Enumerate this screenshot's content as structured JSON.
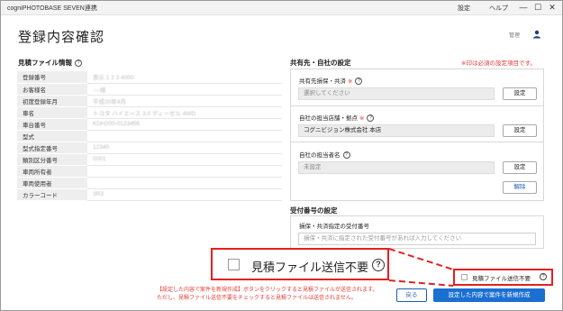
{
  "window": {
    "title": "cogniPHOTOBASE SEVEN連携",
    "menu": {
      "settings": "設定",
      "help": "ヘルプ"
    },
    "minimize": "—",
    "maximize": "☐",
    "close": "✕"
  },
  "header": {
    "title": "登録内容確認",
    "user_name": "管理"
  },
  "estimate": {
    "title": "見積ファイル情報",
    "help": "?",
    "rows": [
      {
        "label": "登録番号",
        "value": "表示 1        2        3        4000"
      },
      {
        "label": "お客様名",
        "value": "○○様"
      },
      {
        "label": "初度登録年月",
        "value": "平成20年4月"
      },
      {
        "label": "車名",
        "value": "トヨタ ハイエース 3.0 ディーゼル 4WD"
      },
      {
        "label": "車台番号",
        "value": "KDH200-0123456"
      },
      {
        "label": "型式",
        "value": ""
      },
      {
        "label": "型式指定番号",
        "value": "12345"
      },
      {
        "label": "類別区分番号",
        "value": "0001"
      },
      {
        "label": "車両所有者",
        "value": ""
      },
      {
        "label": "車両使用者",
        "value": ""
      },
      {
        "label": "カラーコード",
        "value": "3R3"
      }
    ]
  },
  "share": {
    "title": "共有先・自社の設定",
    "required_note": "※印は必須の設定項目です。",
    "insurer": {
      "label": "共有先損保・共済",
      "req": "※",
      "help": "?",
      "placeholder": "選択してください",
      "button": "設定"
    },
    "store": {
      "label": "自社の担当店舗・拠点",
      "req": "※",
      "help": "?",
      "value": "コグニビジョン株式会社 本店",
      "button": "設定"
    },
    "staff": {
      "label": "自社の担当者名",
      "help": "?",
      "value": "未設定",
      "button": "設定",
      "clear_button": "解除"
    }
  },
  "receipt": {
    "title": "受付番号の設定",
    "label": "損保・共済指定の受付番号",
    "placeholder": "損保・共済に指定された受付番号があれば入力してください"
  },
  "no_send": {
    "label": "見積ファイル送信不要",
    "help": "?"
  },
  "footer": {
    "note_line1": "【設定した内容で案件を新規作成】ボタンをクリックすると見積ファイルが送信されます。",
    "note_line2": "ただし、見積ファイル送信不要をチェックすると見積ファイルは送信されません。",
    "back_button": "戻る",
    "create_button": "設定した内容で案件を新規作成"
  },
  "colors": {
    "accent": "#1a6fd1",
    "highlight": "#e52020",
    "required": "#e53935"
  }
}
